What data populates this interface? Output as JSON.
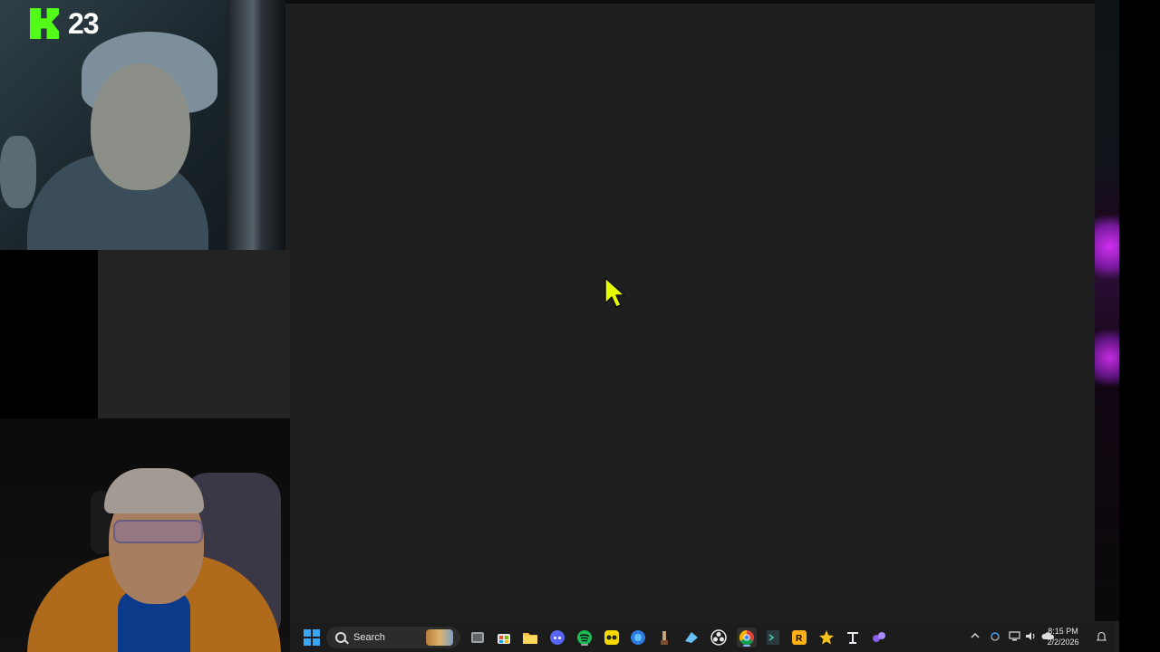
{
  "overlay": {
    "platform_logo": "kick-logo",
    "viewer_count": "23"
  },
  "taskbar": {
    "search_label": "Search",
    "clock_time": "8:15 PM",
    "clock_date": "2/2/2026",
    "pinned_icons": [
      "start-icon",
      "search-icon",
      "widgets-icon",
      "task-view-icon",
      "store-icon",
      "file-explorer-icon",
      "discord-icon",
      "spotify-icon",
      "game-icon",
      "edge-dev-icon",
      "app-icon",
      "steam-icon",
      "obs-icon",
      "chrome-icon",
      "terminal-icon",
      "rockstar-icon",
      "star-icon",
      "epic-icon",
      "app2-icon"
    ],
    "tray_icons": [
      "chevron-up-icon",
      "sync-icon",
      "network-icon",
      "volume-icon",
      "weather-icon",
      "notification-icon"
    ]
  },
  "colors": {
    "kick_green": "#53fc18",
    "cursor_yellow": "#e6ff00",
    "desktop_bg": "#1f1f1f"
  }
}
